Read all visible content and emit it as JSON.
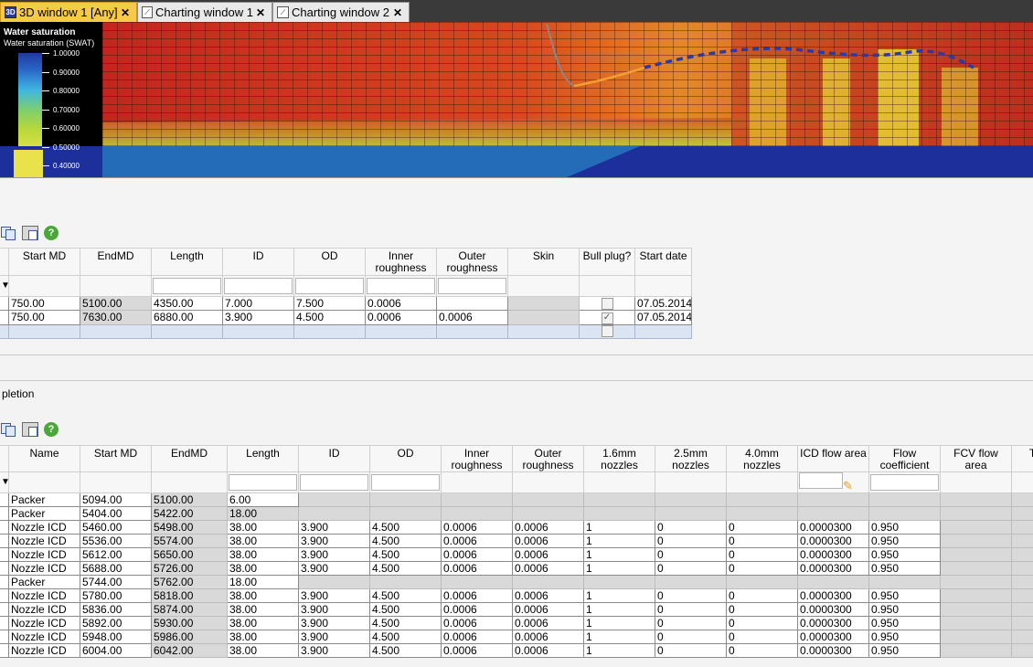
{
  "tabs": [
    {
      "label": "3D window 1 [Any]",
      "icon": "3d-window-icon",
      "icon_text": "3D",
      "active": true
    },
    {
      "label": "Charting window 1",
      "icon": "chart-window-icon",
      "active": false
    },
    {
      "label": "Charting window 2",
      "icon": "chart-window-icon",
      "active": false
    }
  ],
  "tab_close_glyph": "✕",
  "view3d": {
    "legend_title": "Water saturation",
    "legend_subtitle": "Water saturation (SWAT)",
    "legend_labels": [
      "1.00000",
      "0.90000",
      "0.80000",
      "0.70000",
      "0.60000",
      "0.50000",
      "0.40000"
    ]
  },
  "toolbar": {
    "help_glyph": "?"
  },
  "pipe_table": {
    "headers": [
      "Start MD",
      "EndMD",
      "Length",
      "ID",
      "OD",
      "Inner roughness",
      "Outer roughness",
      "Skin",
      "Bull plug?",
      "Start date"
    ],
    "rows": [
      [
        "750.00",
        "5100.00",
        "4350.00",
        "7.000",
        "7.500",
        "0.0006",
        "",
        "",
        false,
        "07.05.2014"
      ],
      [
        "750.00",
        "7630.00",
        "6880.00",
        "3.900",
        "4.500",
        "0.0006",
        "0.0006",
        "",
        true,
        "07.05.2014"
      ]
    ]
  },
  "completion": {
    "section_label": "pletion",
    "headers": [
      "Name",
      "Start MD",
      "EndMD",
      "Length",
      "ID",
      "OD",
      "Inner roughness",
      "Outer roughness",
      "1.6mm nozzles",
      "2.5mm nozzles",
      "4.0mm nozzles",
      "ICD flow area",
      "Flow coefficient",
      "FCV flow area",
      "Tub"
    ],
    "rows": [
      [
        "Packer",
        "5094.00",
        "5100.00",
        "6.00",
        "",
        "",
        "",
        "",
        "",
        "",
        "",
        "",
        "",
        "",
        ""
      ],
      [
        "Packer",
        "5404.00",
        "5422.00",
        "18.00",
        "",
        "",
        "",
        "",
        "",
        "",
        "",
        "",
        "",
        "",
        ""
      ],
      [
        "Nozzle ICD",
        "5460.00",
        "5498.00",
        "38.00",
        "3.900",
        "4.500",
        "0.0006",
        "0.0006",
        "1",
        "0",
        "0",
        "0.0000300",
        "0.950",
        "",
        ""
      ],
      [
        "Nozzle ICD",
        "5536.00",
        "5574.00",
        "38.00",
        "3.900",
        "4.500",
        "0.0006",
        "0.0006",
        "1",
        "0",
        "0",
        "0.0000300",
        "0.950",
        "",
        ""
      ],
      [
        "Nozzle ICD",
        "5612.00",
        "5650.00",
        "38.00",
        "3.900",
        "4.500",
        "0.0006",
        "0.0006",
        "1",
        "0",
        "0",
        "0.0000300",
        "0.950",
        "",
        ""
      ],
      [
        "Nozzle ICD",
        "5688.00",
        "5726.00",
        "38.00",
        "3.900",
        "4.500",
        "0.0006",
        "0.0006",
        "1",
        "0",
        "0",
        "0.0000300",
        "0.950",
        "",
        ""
      ],
      [
        "Packer",
        "5744.00",
        "5762.00",
        "18.00",
        "",
        "",
        "",
        "",
        "",
        "",
        "",
        "",
        "",
        "",
        ""
      ],
      [
        "Nozzle ICD",
        "5780.00",
        "5818.00",
        "38.00",
        "3.900",
        "4.500",
        "0.0006",
        "0.0006",
        "1",
        "0",
        "0",
        "0.0000300",
        "0.950",
        "",
        ""
      ],
      [
        "Nozzle ICD",
        "5836.00",
        "5874.00",
        "38.00",
        "3.900",
        "4.500",
        "0.0006",
        "0.0006",
        "1",
        "0",
        "0",
        "0.0000300",
        "0.950",
        "",
        ""
      ],
      [
        "Nozzle ICD",
        "5892.00",
        "5930.00",
        "38.00",
        "3.900",
        "4.500",
        "0.0006",
        "0.0006",
        "1",
        "0",
        "0",
        "0.0000300",
        "0.950",
        "",
        ""
      ],
      [
        "Nozzle ICD",
        "5948.00",
        "5986.00",
        "38.00",
        "3.900",
        "4.500",
        "0.0006",
        "0.0006",
        "1",
        "0",
        "0",
        "0.0000300",
        "0.950",
        "",
        ""
      ],
      [
        "Nozzle ICD",
        "6004.00",
        "6042.00",
        "38.00",
        "3.900",
        "4.500",
        "0.0006",
        "0.0006",
        "1",
        "0",
        "0",
        "0.0000300",
        "0.950",
        "",
        ""
      ]
    ]
  },
  "colors": {
    "active_tab": "#f7c948",
    "grid_red": "#c0231e",
    "grid_yellow": "#e8d23a",
    "water_blue": "#2233a0",
    "new_row": "#dbe4f3"
  }
}
